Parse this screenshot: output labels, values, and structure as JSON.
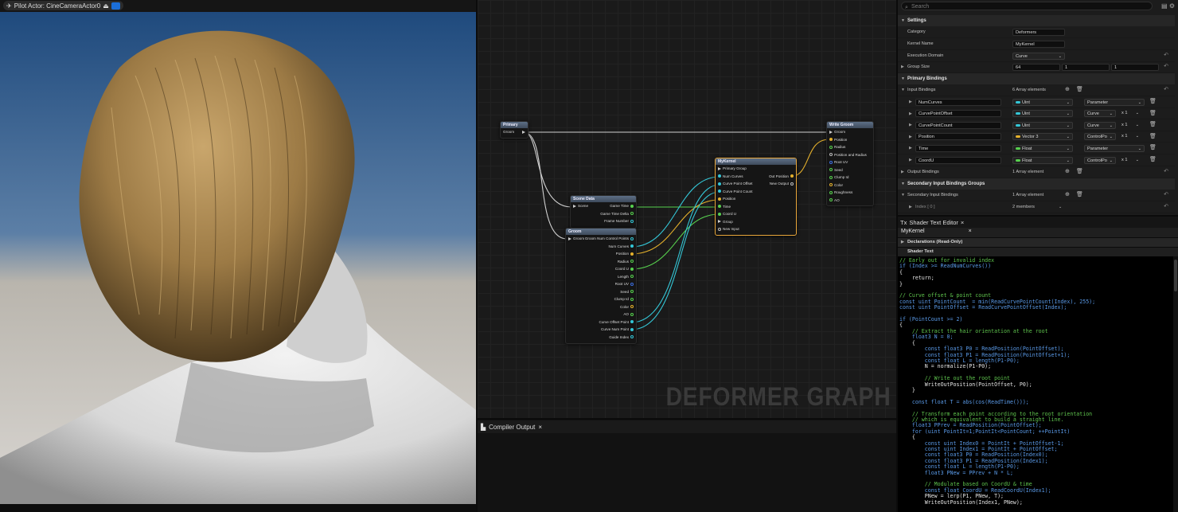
{
  "viewport": {
    "pilot_label": "Pilot Actor: CineCameraActor0"
  },
  "graph": {
    "watermark": "DEFORMER GRAPH",
    "nodes": {
      "primary": {
        "title": "Primary",
        "pin": "Groom"
      },
      "scene_data": {
        "title": "Scene Data",
        "input": "Scene",
        "outputs": [
          "Game Time",
          "Game Time Delta",
          "Frame Number"
        ]
      },
      "groom": {
        "title": "Groom",
        "input": "Groom",
        "outputs": [
          "Groom Num Control Points",
          "Num Curves",
          "Position",
          "Radius",
          "Coord U",
          "Length",
          "Root UV",
          "Seed",
          "Clump Id",
          "Color",
          "AO",
          "Curve Offset Point",
          "Curve Num Point",
          "Guide Index"
        ]
      },
      "kernel": {
        "title": "MyKernel",
        "group": "Primary Group",
        "inputs": [
          "Num Curves",
          "Curve Point Offset",
          "Curve Point Count",
          "Position",
          "Time",
          "Coord U",
          "Group",
          "New Input"
        ],
        "outputs": [
          "Out Position",
          "New Output"
        ]
      },
      "write_groom": {
        "title": "Write Groom",
        "pins": [
          "Groom",
          "Position",
          "Radius",
          "Position and Radius",
          "Root UV",
          "Seed",
          "Clump Id",
          "Color",
          "Roughness",
          "AO"
        ]
      }
    }
  },
  "compiler": {
    "tab_label": "Compiler Output"
  },
  "details": {
    "search_placeholder": "Search",
    "settings": {
      "title": "Settings",
      "category_label": "Category",
      "category_value": "Deformers",
      "kernel_name_label": "Kernel Name",
      "kernel_name_value": "MyKernel",
      "exec_domain_label": "Execution Domain",
      "exec_domain_value": "Curve",
      "group_size_label": "Group Size",
      "group_size_values": [
        "64",
        "1",
        "1"
      ]
    },
    "primary_bindings": {
      "title": "Primary Bindings",
      "input_bindings_label": "Input Bindings",
      "input_bindings_count": "6 Array elements",
      "rows": [
        {
          "name": "NumCurves",
          "type": "Uint",
          "color": "#34c7d7",
          "domain": "Parameter",
          "mult": ""
        },
        {
          "name": "CurvePointOffset",
          "type": "Uint",
          "color": "#34c7d7",
          "domain": "Curve",
          "mult": "x 1"
        },
        {
          "name": "CurvePointCount",
          "type": "Uint",
          "color": "#34c7d7",
          "domain": "Curve",
          "mult": "x 1"
        },
        {
          "name": "Position",
          "type": "Vector 3",
          "color": "#e5b12c",
          "domain": "ControlPo",
          "mult": "x 1"
        },
        {
          "name": "Time",
          "type": "Float",
          "color": "#57d14e",
          "domain": "Parameter",
          "mult": ""
        },
        {
          "name": "CoordU",
          "type": "Float",
          "color": "#57d14e",
          "domain": "ControlPo",
          "mult": "x 1"
        }
      ],
      "output_bindings_label": "Output Bindings",
      "output_bindings_count": "1 Array element"
    },
    "secondary": {
      "title": "Secondary Input Bindings Groups",
      "bindings_label": "Secondary Input Bindings",
      "bindings_count": "1 Array element",
      "index_label": "Index [ 0 ]",
      "index_value": "2 members"
    }
  },
  "shader": {
    "tab_label": "Shader Text Editor",
    "sub_tab": "MyKernel",
    "declarations": "Declarations (Read-Only)",
    "shader_text": "Shader Text",
    "code": [
      "// Early out for invalid index",
      "if (Index >= ReadNumCurves())",
      "{",
      "    return;",
      "}",
      "",
      "// Curve offset & point count",
      "const uint PointCount  = min(ReadCurvePointCount(Index), 255);",
      "const uint PointOffset = ReadCurvePointOffset(Index);",
      "",
      "if (PointCount >= 2)",
      "{",
      "    // Extract the hair orientation at the root",
      "    float3 N = 0;",
      "    {",
      "        const float3 P0 = ReadPosition(PointOffset);",
      "        const float3 P1 = ReadPosition(PointOffset+1);",
      "        const float L = length(P1-P0);",
      "        N = normalize(P1-P0);",
      "",
      "        // Write out the root point",
      "        WriteOutPosition(PointOffset, P0);",
      "    }",
      "",
      "    const float T = abs(cos(ReadTime()));",
      "",
      "    // Transform each point according to the root orientation",
      "    // which is equivalent to build a straight line.",
      "    float3 PPrev = ReadPosition(PointOffset);",
      "    for (uint PointIt=1;PointIt<PointCount; ++PointIt)",
      "    {",
      "        const uint Index0 = PointIt + PointOffset-1;",
      "        const uint Index1 = PointIt + PointOffset;",
      "        const float3 P0 = ReadPosition(Index0);",
      "        const float3 P1 = ReadPosition(Index1);",
      "        const float L = length(P1-P0);",
      "        float3 PNew = PPrev + N * L;",
      "",
      "        // Modulate based on CoordU & time",
      "        const float CoordU = ReadCoordU(Index1);",
      "        PNew = lerp(P1, PNew, T);",
      "        WriteOutPosition(Index1, PNew);"
    ]
  }
}
